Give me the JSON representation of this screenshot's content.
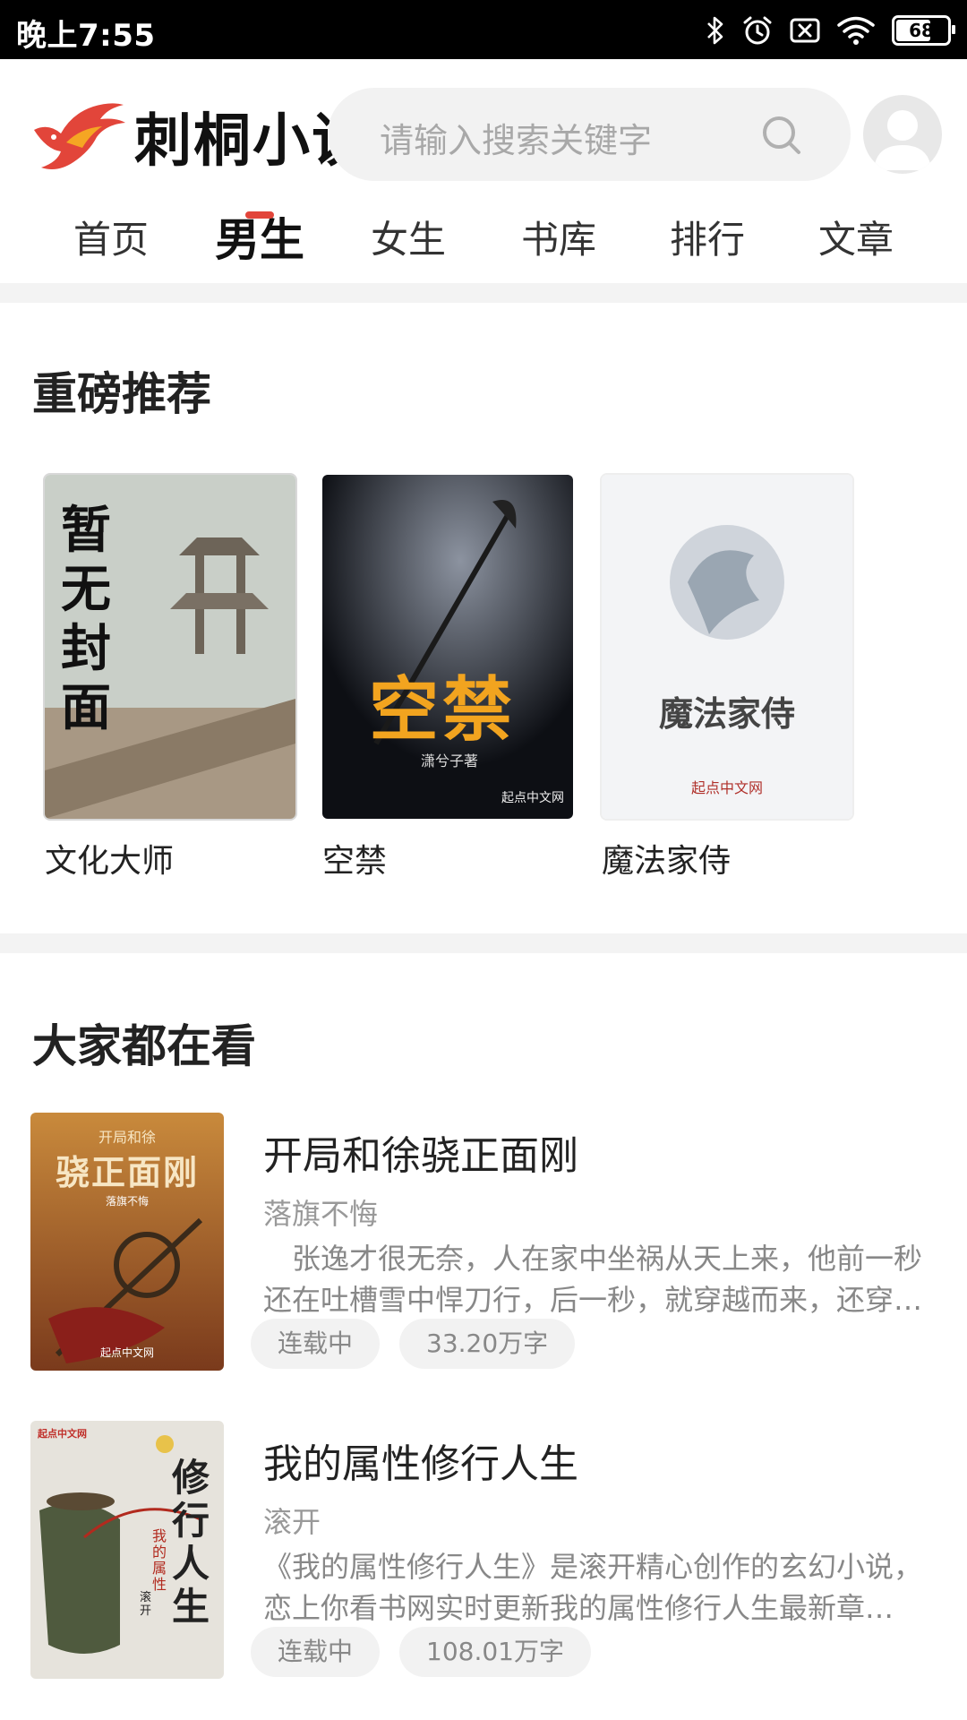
{
  "status_bar": {
    "time": "晚上7:55",
    "battery": "68",
    "battery_level_percent": 68,
    "icons": [
      "bluetooth-icon",
      "alarm-icon",
      "sim-disabled-icon",
      "wifi-icon",
      "battery-icon"
    ]
  },
  "header": {
    "app_name": "刺桐小说",
    "search_placeholder": "请输入搜索关键字",
    "brand_color": "#e2453a"
  },
  "tabs": [
    {
      "label": "首页",
      "active": false
    },
    {
      "label": "男生",
      "active": true
    },
    {
      "label": "女生",
      "active": false
    },
    {
      "label": "书库",
      "active": false
    },
    {
      "label": "排行",
      "active": false
    },
    {
      "label": "文章",
      "active": false
    }
  ],
  "featured": {
    "title": "重磅推荐",
    "books": [
      {
        "title": "文化大师",
        "cover_text": "暂无封面"
      },
      {
        "title": "空禁",
        "cover_text": "空禁",
        "cover_author": "潇兮子著",
        "cover_publisher": "起点中文网"
      },
      {
        "title": "魔法家侍",
        "cover_text": "魔法家侍",
        "cover_publisher": "起点中文网"
      }
    ]
  },
  "popular": {
    "title": "大家都在看",
    "books": [
      {
        "title": "开局和徐骁正面刚",
        "author": "落旗不悔",
        "description": "张逸才很无奈，人在家中坐祸从天上来，他前一秒还在吐槽雪中悍刀行，后一秒，就穿越而来，还穿越成了……",
        "status": "连载中",
        "word_count": "33.20万字",
        "cover_lines": [
          "开局和徐",
          "骁正面刚"
        ],
        "cover_author": "落旗不悔",
        "cover_publisher": "起点中文网"
      },
      {
        "title": "我的属性修行人生",
        "author": "滚开",
        "description": "《我的属性修行人生》是滚开精心创作的玄幻小说，恋上你看书网实时更新我的属性修行人生最新章节……",
        "status": "连载中",
        "word_count": "108.01万字",
        "cover_title": "修行人生",
        "cover_subtitle": "我的属性",
        "cover_author": "滚开",
        "cover_publisher": "起点中文网"
      }
    ]
  }
}
